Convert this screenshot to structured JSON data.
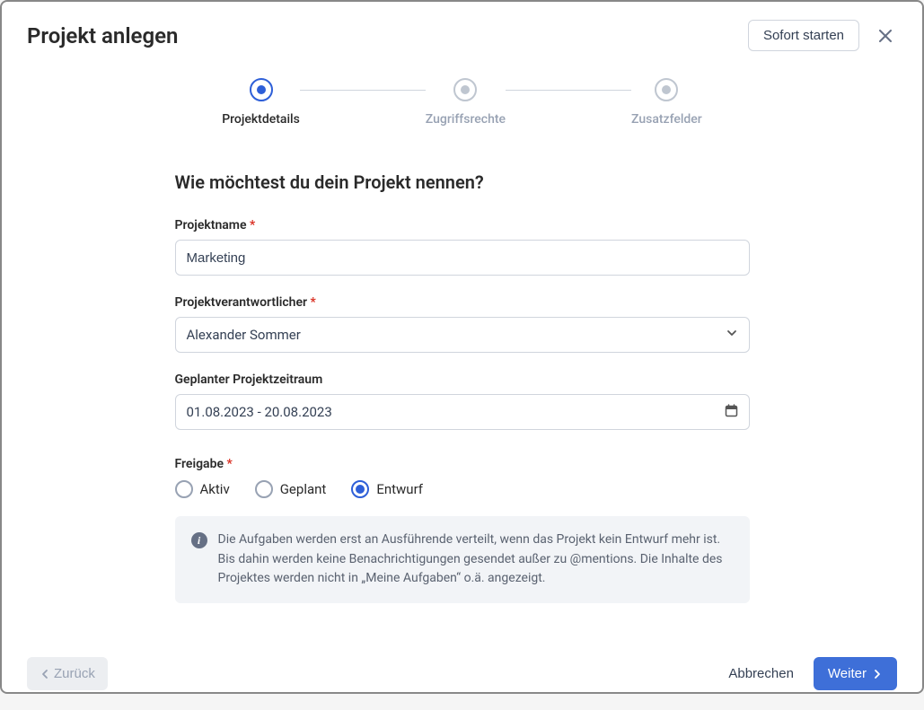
{
  "header": {
    "title": "Projekt anlegen",
    "startNow": "Sofort starten"
  },
  "stepper": {
    "step1": "Projektdetails",
    "step2": "Zugriffsrechte",
    "step3": "Zusatzfelder"
  },
  "form": {
    "heading": "Wie möchtest du dein Projekt nennen?",
    "nameLabel": "Projektname",
    "nameValue": "Marketing",
    "ownerLabel": "Projektverantwortlicher",
    "ownerValue": "Alexander Sommer",
    "periodLabel": "Geplanter Projektzeitraum",
    "periodValue": "01.08.2023 - 20.08.2023",
    "releaseLabel": "Freigabe",
    "releaseOptions": {
      "aktiv": "Aktiv",
      "geplant": "Geplant",
      "entwurf": "Entwurf"
    },
    "infoText": "Die Aufgaben werden erst an Ausführende verteilt, wenn das Projekt kein Entwurf mehr ist. Bis dahin werden keine Benachrichtigungen gesendet außer zu @mentions. Die Inhalte des Projektes werden nicht in „Meine Aufgaben“ o.ä. angezeigt."
  },
  "footer": {
    "back": "Zurück",
    "cancel": "Abbrechen",
    "next": "Weiter"
  }
}
